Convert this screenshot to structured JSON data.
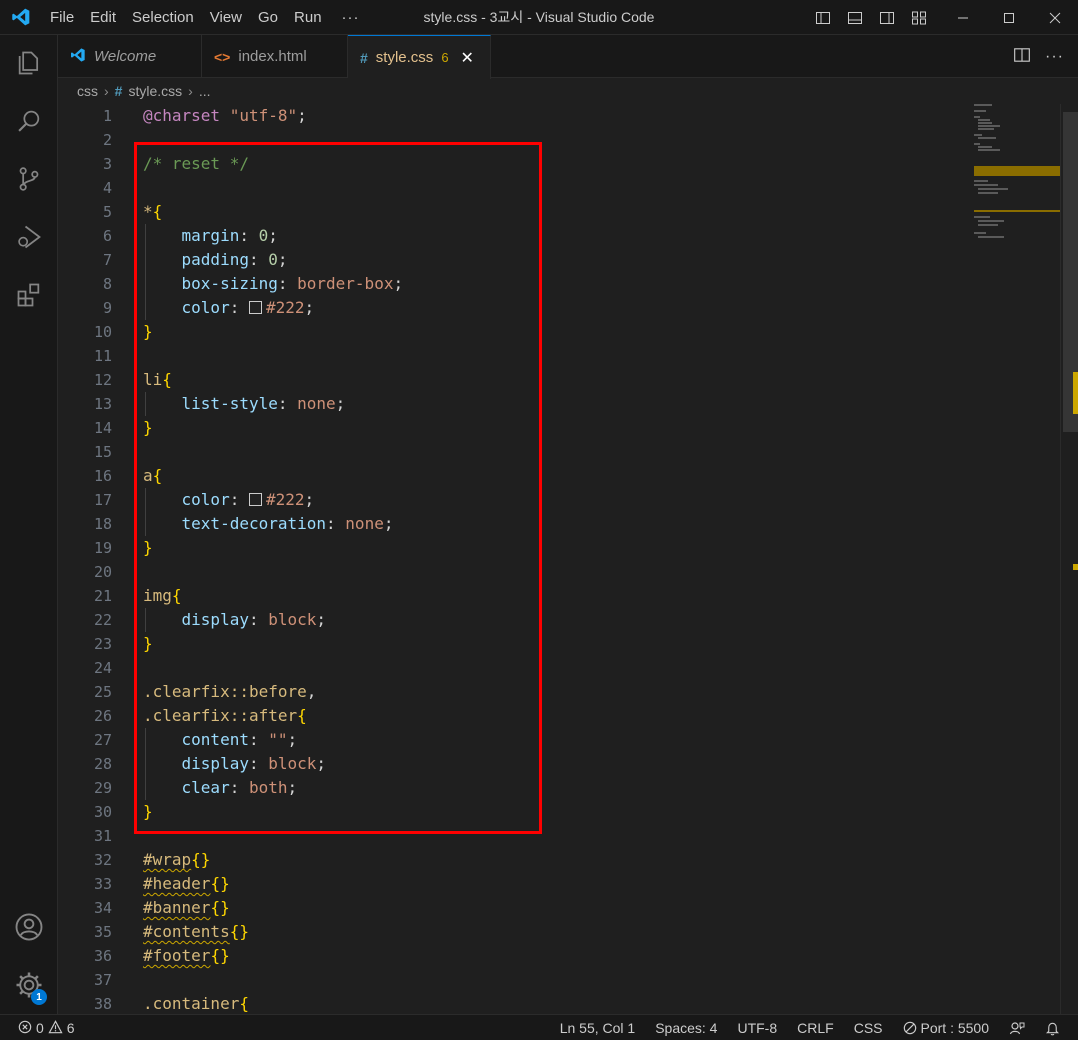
{
  "window": {
    "title": "style.css - 3교시 - Visual Studio Code",
    "menu": [
      "File",
      "Edit",
      "Selection",
      "View",
      "Go",
      "Run",
      "···"
    ]
  },
  "tabs": [
    {
      "label": "Welcome",
      "icon": "vscode-logo-icon"
    },
    {
      "label": "index.html",
      "icon": "html-icon"
    },
    {
      "label": "style.css",
      "icon": "css-hash-icon",
      "problems": "6",
      "active": true
    }
  ],
  "breadcrumb": {
    "folder": "css",
    "file": "style.css",
    "more": "..."
  },
  "editor": {
    "lines": [
      {
        "n": "1",
        "tokens": [
          [
            "at",
            "@charset"
          ],
          [
            "punc",
            " "
          ],
          [
            "str",
            "\"utf-8\""
          ],
          [
            "punc",
            ";"
          ]
        ]
      },
      {
        "n": "2",
        "tokens": []
      },
      {
        "n": "3",
        "tokens": [
          [
            "cmt",
            "/* reset */"
          ]
        ]
      },
      {
        "n": "4",
        "tokens": []
      },
      {
        "n": "5",
        "tokens": [
          [
            "star",
            "*"
          ],
          [
            "brace",
            "{"
          ]
        ]
      },
      {
        "n": "6",
        "indent": true,
        "tokens": [
          [
            "prop",
            "margin"
          ],
          [
            "punc",
            ": "
          ],
          [
            "num",
            "0"
          ],
          [
            "punc",
            ";"
          ]
        ]
      },
      {
        "n": "7",
        "indent": true,
        "tokens": [
          [
            "prop",
            "padding"
          ],
          [
            "punc",
            ": "
          ],
          [
            "num",
            "0"
          ],
          [
            "punc",
            ";"
          ]
        ]
      },
      {
        "n": "8",
        "indent": true,
        "tokens": [
          [
            "prop",
            "box-sizing"
          ],
          [
            "punc",
            ": "
          ],
          [
            "val",
            "border-box"
          ],
          [
            "punc",
            ";"
          ]
        ]
      },
      {
        "n": "9",
        "indent": true,
        "tokens": [
          [
            "prop",
            "color"
          ],
          [
            "punc",
            ": "
          ],
          [
            "swatch",
            ""
          ],
          [
            "val",
            "#222"
          ],
          [
            "punc",
            ";"
          ]
        ]
      },
      {
        "n": "10",
        "tokens": [
          [
            "brace",
            "}"
          ]
        ]
      },
      {
        "n": "11",
        "tokens": []
      },
      {
        "n": "12",
        "tokens": [
          [
            "sel",
            "li"
          ],
          [
            "brace",
            "{"
          ]
        ]
      },
      {
        "n": "13",
        "indent": true,
        "tokens": [
          [
            "prop",
            "list-style"
          ],
          [
            "punc",
            ": "
          ],
          [
            "val",
            "none"
          ],
          [
            "punc",
            ";"
          ]
        ]
      },
      {
        "n": "14",
        "tokens": [
          [
            "brace",
            "}"
          ]
        ]
      },
      {
        "n": "15",
        "tokens": []
      },
      {
        "n": "16",
        "tokens": [
          [
            "sel",
            "a"
          ],
          [
            "brace",
            "{"
          ]
        ]
      },
      {
        "n": "17",
        "indent": true,
        "tokens": [
          [
            "prop",
            "color"
          ],
          [
            "punc",
            ": "
          ],
          [
            "swatch",
            ""
          ],
          [
            "val",
            "#222"
          ],
          [
            "punc",
            ";"
          ]
        ]
      },
      {
        "n": "18",
        "indent": true,
        "tokens": [
          [
            "prop",
            "text-decoration"
          ],
          [
            "punc",
            ": "
          ],
          [
            "val",
            "none"
          ],
          [
            "punc",
            ";"
          ]
        ]
      },
      {
        "n": "19",
        "tokens": [
          [
            "brace",
            "}"
          ]
        ]
      },
      {
        "n": "20",
        "tokens": []
      },
      {
        "n": "21",
        "tokens": [
          [
            "sel",
            "img"
          ],
          [
            "brace",
            "{"
          ]
        ]
      },
      {
        "n": "22",
        "indent": true,
        "tokens": [
          [
            "prop",
            "display"
          ],
          [
            "punc",
            ": "
          ],
          [
            "val",
            "block"
          ],
          [
            "punc",
            ";"
          ]
        ]
      },
      {
        "n": "23",
        "tokens": [
          [
            "brace",
            "}"
          ]
        ]
      },
      {
        "n": "24",
        "tokens": []
      },
      {
        "n": "25",
        "tokens": [
          [
            "sel",
            ".clearfix::before"
          ],
          [
            "punc",
            ","
          ]
        ]
      },
      {
        "n": "26",
        "tokens": [
          [
            "sel",
            ".clearfix::after"
          ],
          [
            "brace",
            "{"
          ]
        ]
      },
      {
        "n": "27",
        "indent": true,
        "tokens": [
          [
            "prop",
            "content"
          ],
          [
            "punc",
            ": "
          ],
          [
            "str",
            "\"\""
          ],
          [
            "punc",
            ";"
          ]
        ]
      },
      {
        "n": "28",
        "indent": true,
        "tokens": [
          [
            "prop",
            "display"
          ],
          [
            "punc",
            ": "
          ],
          [
            "val",
            "block"
          ],
          [
            "punc",
            ";"
          ]
        ]
      },
      {
        "n": "29",
        "indent": true,
        "tokens": [
          [
            "prop",
            "clear"
          ],
          [
            "punc",
            ": "
          ],
          [
            "val",
            "both"
          ],
          [
            "punc",
            ";"
          ]
        ]
      },
      {
        "n": "30",
        "tokens": [
          [
            "brace",
            "}"
          ]
        ]
      },
      {
        "n": "31",
        "tokens": []
      },
      {
        "n": "32",
        "tokens": [
          [
            "sel squig",
            "#wrap"
          ],
          [
            "brace",
            "{}"
          ]
        ]
      },
      {
        "n": "33",
        "tokens": [
          [
            "sel squig",
            "#header"
          ],
          [
            "brace",
            "{}"
          ]
        ]
      },
      {
        "n": "34",
        "tokens": [
          [
            "sel squig",
            "#banner"
          ],
          [
            "brace",
            "{}"
          ]
        ]
      },
      {
        "n": "35",
        "tokens": [
          [
            "sel squig",
            "#contents"
          ],
          [
            "brace",
            "{}"
          ]
        ]
      },
      {
        "n": "36",
        "tokens": [
          [
            "sel squig",
            "#footer"
          ],
          [
            "brace",
            "{}"
          ]
        ]
      },
      {
        "n": "37",
        "tokens": []
      },
      {
        "n": "38",
        "tokens": [
          [
            "sel",
            ".container"
          ],
          [
            "brace",
            "{"
          ]
        ]
      }
    ]
  },
  "statusbar": {
    "errors": "0",
    "warnings": "6",
    "position": "Ln 55, Col 1",
    "spaces": "Spaces: 4",
    "encoding": "UTF-8",
    "eol": "CRLF",
    "language": "CSS",
    "port": "Port : 5500"
  },
  "activity": {
    "accounts_badge": "1"
  },
  "colors": {
    "accent": "#0078d4",
    "highlight_box": "#ff0000",
    "warning": "#cca700"
  }
}
